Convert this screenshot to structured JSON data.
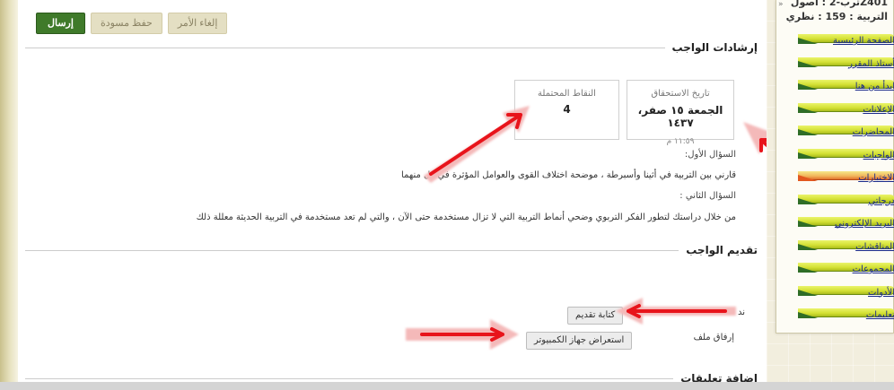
{
  "toolbar": {
    "send_label": "إرسال",
    "save_draft_label": "حفظ مسودة",
    "cancel_label": "إلغاء الأمر"
  },
  "instructions": {
    "title": "إرشادات الواجب",
    "due": {
      "label": "تاريخ الاستحقاق",
      "date": "الجمعة ١٥ صفر، ١٤٣٧",
      "time": "١١:٥٩ م"
    },
    "points": {
      "label": "النقاط المحتملة",
      "value": "4"
    },
    "question1_label": "السؤال الأول:",
    "question1_text": "قارني بين التربية في أثينا وأسبرطة ، موضحة اختلاف القوى والعوامل المؤثرة في كل منهما",
    "question2_label": "السؤال الثاني :",
    "question2_text": "من خلال دراستك لتطور الفكر التربوي وضحي أنماط التربية التي لا تزال مستخدمة حتى الآن ، والتي لم تعد مستخدمة في التربية الحديثة معللة ذلك"
  },
  "submission": {
    "title": "تقديم الواجب",
    "text_row_label": "ند",
    "write_submission_label": "كتابة تقديم",
    "attach_file_label": "إرفاق ملف",
    "browse_computer_label": "استعراض جهاز الكمبيوتر"
  },
  "comments": {
    "title": "إضافة تعليقات"
  },
  "sidebar": {
    "course_line1": "Z401ترب-2 : أصول",
    "course_line2": "التربية : 159 : نظري",
    "collapse_icon": "double-arrow-icon",
    "items": [
      {
        "label": "الصفحة الرئيسية"
      },
      {
        "label": "أستاذ المقرر"
      },
      {
        "label": "ابدأ من هنا"
      },
      {
        "label": "الإعلانات"
      },
      {
        "label": "المحاضرات"
      },
      {
        "label": "الواجبات"
      },
      {
        "label": "الاختبارات"
      },
      {
        "label": "درجاتي"
      },
      {
        "label": "البريد الإلكتروني"
      },
      {
        "label": "المناقشات"
      },
      {
        "label": "المجموعات"
      },
      {
        "label": "الأدوات"
      },
      {
        "label": "تعليمات"
      }
    ],
    "active_index": 6
  },
  "colors": {
    "send_button": "#3f7a2a",
    "menu_bar": "#d3e033",
    "menu_bar_active": "#f1b45a",
    "arrow": "#e8141b"
  }
}
